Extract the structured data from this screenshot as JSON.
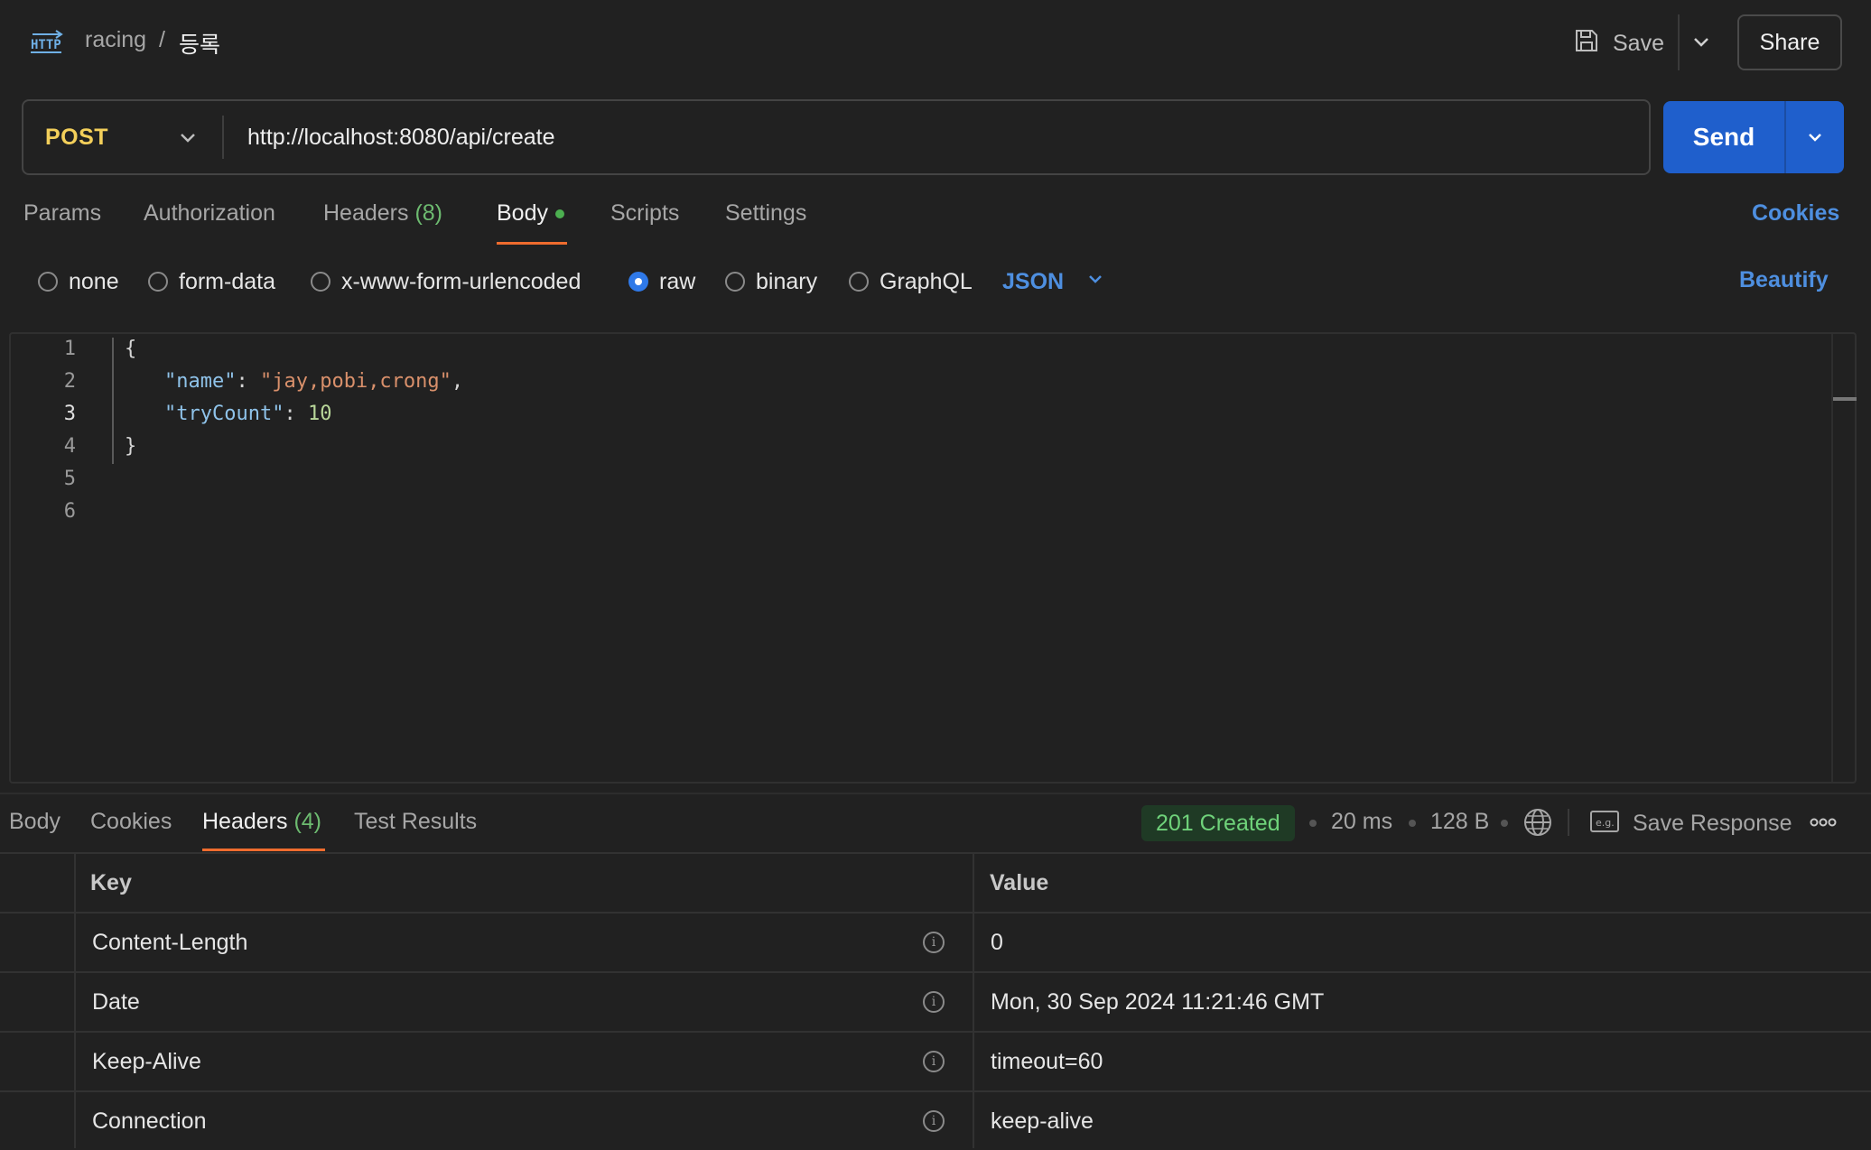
{
  "header": {
    "breadcrumb": [
      "racing",
      "/",
      "등록"
    ],
    "save_label": "Save",
    "share_label": "Share",
    "icon": "http-icon"
  },
  "request": {
    "method": "POST",
    "url": "http://localhost:8080/api/create",
    "send_label": "Send"
  },
  "request_tabs": [
    {
      "label": "Params"
    },
    {
      "label": "Authorization"
    },
    {
      "label": "Headers",
      "count": "(8)"
    },
    {
      "label": "Body"
    },
    {
      "label": "Scripts"
    },
    {
      "label": "Settings"
    }
  ],
  "cookies_label": "Cookies",
  "body_options": {
    "items": [
      "none",
      "form-data",
      "x-www-form-urlencoded",
      "raw",
      "binary",
      "GraphQL"
    ],
    "selected": "raw",
    "format": "JSON",
    "beautify_label": "Beautify"
  },
  "editor": {
    "line_numbers": [
      "1",
      "2",
      "3",
      "4",
      "5",
      "6"
    ],
    "current_line": "3",
    "lines": [
      "{",
      "    \"name\": \"jay,pobi,crong\",",
      "    \"tryCount\": 10",
      "}",
      "",
      ""
    ],
    "tokens": {
      "open": "{",
      "key1": "\"name\"",
      "colon": ": ",
      "val1": "\"jay,pobi,crong\"",
      "comma": ",",
      "key2": "\"tryCount\"",
      "val2": "10",
      "close": "}"
    }
  },
  "response": {
    "tabs": [
      {
        "label": "Body"
      },
      {
        "label": "Cookies"
      },
      {
        "label": "Headers",
        "count": "(4)"
      },
      {
        "label": "Test Results"
      }
    ],
    "status": "201 Created",
    "time": "20 ms",
    "size": "128 B",
    "save_response_label": "Save Response",
    "colors": {
      "status_bg": "#1f3a25",
      "status_fg": "#6fd27a",
      "accent": "#ef6c2e",
      "send": "#1f5fcc"
    },
    "table": {
      "headers": {
        "key": "Key",
        "value": "Value"
      },
      "rows": [
        {
          "key": "Content-Length",
          "value": "0"
        },
        {
          "key": "Date",
          "value": "Mon, 30 Sep 2024 11:21:46 GMT"
        },
        {
          "key": "Keep-Alive",
          "value": "timeout=60"
        },
        {
          "key": "Connection",
          "value": "keep-alive"
        }
      ]
    }
  }
}
